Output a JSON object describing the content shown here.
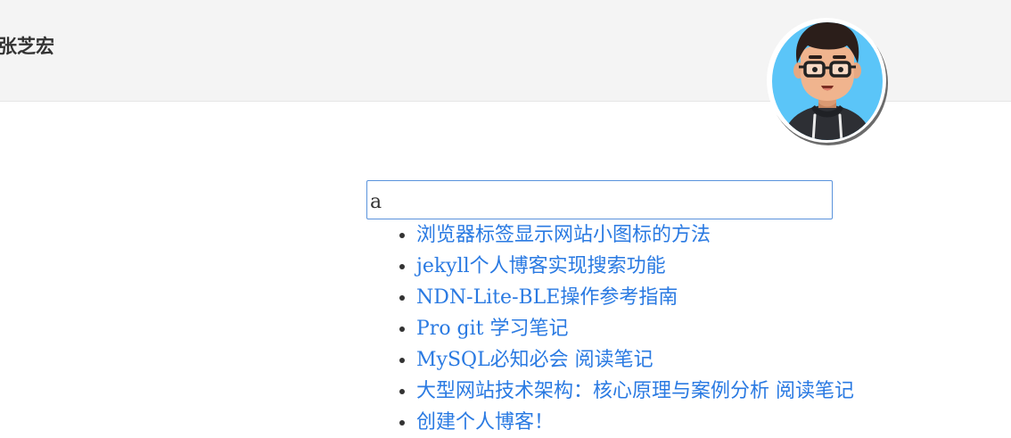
{
  "header": {
    "site_title": "张芝宏",
    "avatar_icon": "avatar-icon"
  },
  "search": {
    "value": "a",
    "placeholder": ""
  },
  "results": [
    {
      "title": "浏览器标签显示网站小图标的方法"
    },
    {
      "title": "jekyll个人博客实现搜索功能"
    },
    {
      "title": "NDN-Lite-BLE操作参考指南"
    },
    {
      "title": "Pro git 学习笔记"
    },
    {
      "title": "MySQL必知必会 阅读笔记"
    },
    {
      "title": "大型网站技术架构：核心原理与案例分析 阅读笔记"
    },
    {
      "title": "创建个人博客！"
    }
  ],
  "colors": {
    "header_bg": "#f4f4f4",
    "link": "#2a7ae2",
    "text": "#333333",
    "input_border": "#5a93dc",
    "avatar_bg": "#5bc5f8"
  }
}
